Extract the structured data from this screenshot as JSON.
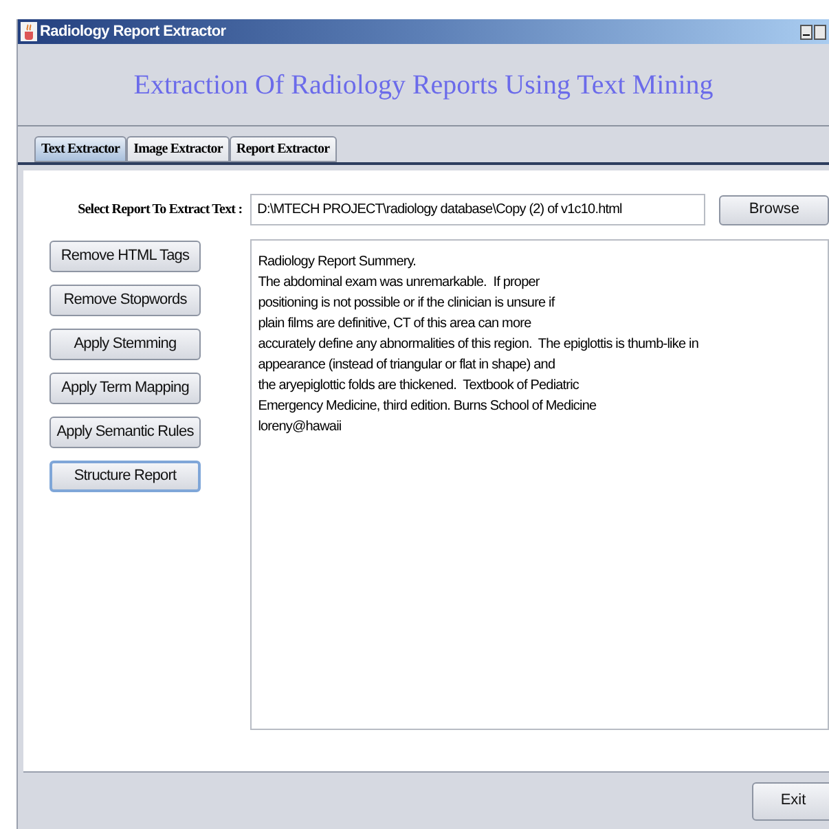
{
  "window": {
    "title": "Radiology Report Extractor"
  },
  "heading": "Extraction Of Radiology Reports Using Text Mining",
  "tabs": [
    {
      "label": "Text Extractor",
      "selected": true
    },
    {
      "label": "Image Extractor",
      "selected": false
    },
    {
      "label": "Report Extractor",
      "selected": false
    }
  ],
  "file_select": {
    "label": "Select Report To Extract Text :",
    "value": "D:\\MTECH PROJECT\\radiology database\\Copy (2) of v1c10.html",
    "button": "Browse"
  },
  "actions": [
    {
      "label": "Remove HTML Tags",
      "focused": false
    },
    {
      "label": "Remove Stopwords",
      "focused": false
    },
    {
      "label": "Apply Stemming",
      "focused": false
    },
    {
      "label": "Apply Term Mapping",
      "focused": false
    },
    {
      "label": "Apply Semantic Rules",
      "focused": false
    },
    {
      "label": "Structure Report",
      "focused": true
    }
  ],
  "report_lines": [
    "Radiology Report Summery.",
    "The abdominal exam was unremarkable.  If proper",
    "positioning is not possible or if the clinician is unsure if",
    "plain films are definitive, CT of this area can more",
    "accurately define any abnormalities of this region.  The epiglottis is thumb-like in",
    "appearance (instead of triangular or flat in shape) and",
    "the aryepiglottic folds are thickened.  Textbook of Pediatric",
    "Emergency Medicine, third edition. Burns School of Medicine",
    "loreny@hawaii"
  ],
  "footer_button": "Exit"
}
